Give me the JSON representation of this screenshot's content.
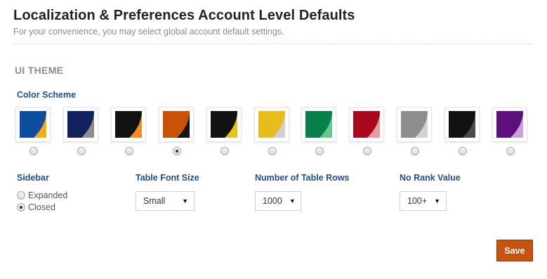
{
  "header": {
    "title": "Localization & Preferences Account Level Defaults",
    "subtitle": "For your convenience, you may select global account default settings."
  },
  "ui_theme": {
    "section_title": "UI THEME",
    "color_scheme_label": "Color Scheme",
    "selected_index": 3,
    "swatches": [
      {
        "main": "#0d4ea1",
        "accent": "#f5ad16"
      },
      {
        "main": "#14215f",
        "accent": "#8e8e8e"
      },
      {
        "main": "#121212",
        "accent": "#f18d1c"
      },
      {
        "main": "#c85305",
        "accent": "#151515"
      },
      {
        "main": "#121212",
        "accent": "#e8c21c"
      },
      {
        "main": "#e6bd1a",
        "accent": "#d0d0d0"
      },
      {
        "main": "#08804a",
        "accent": "#66c98e"
      },
      {
        "main": "#a8091c",
        "accent": "#e69aa1"
      },
      {
        "main": "#8d8d8d",
        "accent": "#d2d2d2"
      },
      {
        "main": "#121212",
        "accent": "#4b4b4b"
      },
      {
        "main": "#5d0f7c",
        "accent": "#caa3d9"
      }
    ]
  },
  "sidebar": {
    "label": "Sidebar",
    "options": [
      "Expanded",
      "Closed"
    ],
    "selected": "Closed"
  },
  "table_font_size": {
    "label": "Table Font Size",
    "value": "Small"
  },
  "table_rows": {
    "label": "Number of Table Rows",
    "value": "1000"
  },
  "no_rank": {
    "label": "No Rank Value",
    "value": "100+"
  },
  "actions": {
    "save_label": "Save",
    "save_color": "#c8530f"
  }
}
